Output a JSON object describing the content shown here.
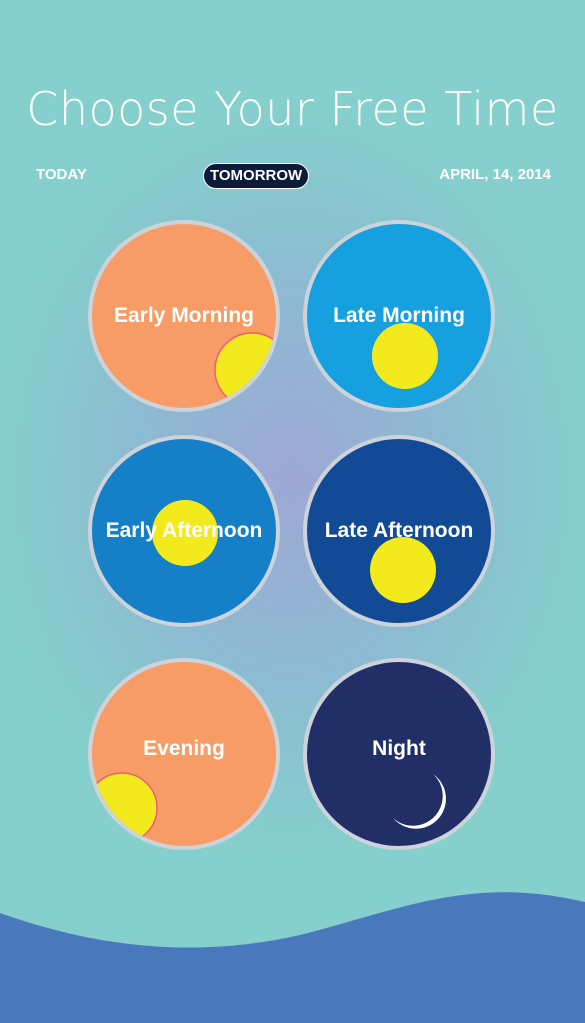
{
  "header": {
    "title": "Choose Your Free Time"
  },
  "day_tabs": {
    "today": "TODAY",
    "tomorrow": "TOMORROW",
    "date": "APRIL, 14, 2014",
    "selected": "TOMORROW"
  },
  "time_slots": [
    {
      "label": "Early Morning",
      "icon": "sun-icon",
      "color": "#f79c66"
    },
    {
      "label": "Late Morning",
      "icon": "sun-icon",
      "color": "#16a0e0"
    },
    {
      "label": "Early Afternoon",
      "icon": "sun-icon",
      "color": "#1580c8"
    },
    {
      "label": "Late Afternoon",
      "icon": "sun-icon",
      "color": "#124a96"
    },
    {
      "label": "Evening",
      "icon": "sun-icon",
      "color": "#f79c66"
    },
    {
      "label": "Night",
      "icon": "moon-icon",
      "color": "#222f66"
    }
  ],
  "colors": {
    "sun": "#f2ea1c",
    "wave": "#4a78bc",
    "tab_highlight": "#0d1b3a",
    "circle_border": "#cdd3da"
  }
}
